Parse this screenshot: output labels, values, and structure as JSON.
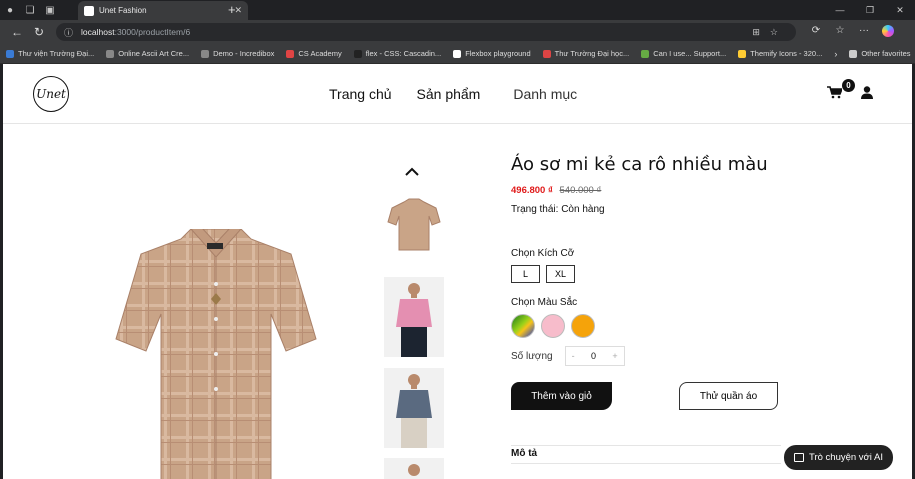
{
  "browser": {
    "tab_title": "Unet Fashion",
    "url_host": "localhost",
    "url_path": ":3000/productItem/6",
    "bookmarks": [
      "Thư viện Trường Đại...",
      "Online Ascii Art Cre...",
      "Demo - Incredibox",
      "CS Academy",
      "flex - CSS: Cascadin...",
      "Flexbox playground",
      "Thư Trường Đại học...",
      "Can I use... Support...",
      "Themify Icons - 320..."
    ],
    "other_favorites": "Other favorites"
  },
  "header": {
    "logo_text": "Unet",
    "menu": [
      "Trang chủ",
      "Sản phẩm",
      "Danh mục"
    ],
    "cart_count": "0"
  },
  "product": {
    "title": "Áo sơ mi kẻ ca rô nhiều màu",
    "price": "496.800 ₫",
    "old_price": "540.000 ₫",
    "status": "Trạng thái: Còn hàng",
    "size_label": "Chọn Kích Cỡ",
    "sizes": [
      "L",
      "XL"
    ],
    "color_label": "Chọn Màu Sắc",
    "colors": [
      "gradient",
      "#f7bccb",
      "#f5a30a"
    ],
    "qty_label": "Số lượng",
    "qty_value": "0",
    "qty_minus": "-",
    "qty_plus": "+",
    "add_to_cart": "Thêm vào giỏ",
    "try_on": "Thử quần áo",
    "description_tab": "Mô tả"
  },
  "chat": {
    "label": "Trò chuyện với AI"
  }
}
